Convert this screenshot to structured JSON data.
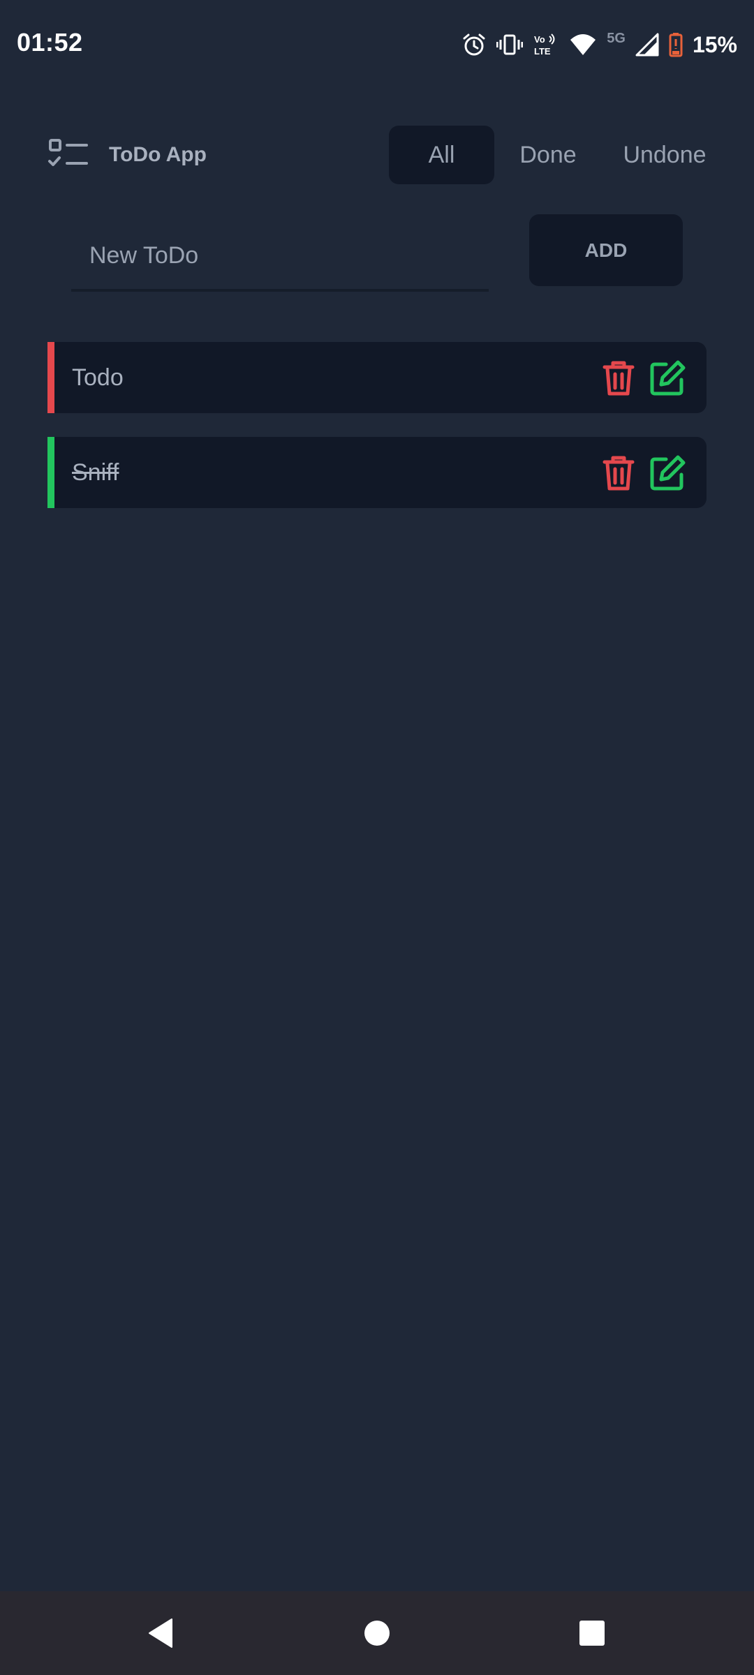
{
  "status_bar": {
    "time": "01:52",
    "battery_percent": "15%",
    "network_label": "5G",
    "icons": [
      "alarm-icon",
      "vibrate-icon",
      "volte-icon",
      "wifi-icon",
      "cell-signal-icon",
      "battery-icon"
    ]
  },
  "header": {
    "title": "ToDo App",
    "logo_icon": "checklist-icon",
    "filters": [
      {
        "label": "All",
        "active": true
      },
      {
        "label": "Done",
        "active": false
      },
      {
        "label": "Undone",
        "active": false
      }
    ]
  },
  "new_todo": {
    "placeholder": "New ToDo",
    "value": "",
    "add_label": "ADD"
  },
  "todos": [
    {
      "text": "Todo",
      "done": false,
      "status_color": "#e5484d"
    },
    {
      "text": "Sniff",
      "done": true,
      "status_color": "#22c55e"
    }
  ],
  "colors": {
    "background": "#1f2838",
    "card": "#111827",
    "delete_icon": "#e5484d",
    "edit_icon": "#22c55e",
    "undone_bar": "#e5484d",
    "done_bar": "#22c55e"
  },
  "nav_bar": {
    "buttons": [
      "back-icon",
      "home-icon",
      "recents-icon"
    ]
  }
}
